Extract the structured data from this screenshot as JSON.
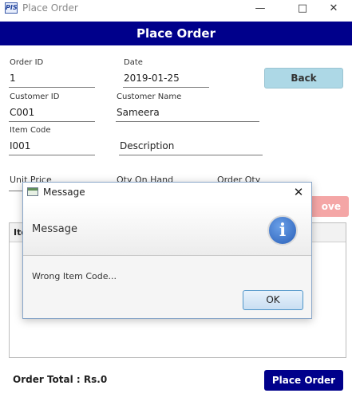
{
  "window": {
    "title": "Place Order",
    "icon": "app-logo-icon",
    "logo_text": "PIS"
  },
  "header": {
    "title": "Place Order"
  },
  "form": {
    "order_id": {
      "label": "Order ID",
      "value": "1"
    },
    "date": {
      "label": "Date",
      "value": "2019-01-25"
    },
    "customer_id": {
      "label": "Customer ID",
      "value": "C001"
    },
    "customer_name": {
      "label": "Customer Name",
      "value": "Sameera"
    },
    "item_code": {
      "label": "Item Code",
      "value": "I001"
    },
    "description": {
      "placeholder": "Description",
      "value": ""
    },
    "unit_price": {
      "label": "Unit Price"
    },
    "qty_on_hand": {
      "label": "Qty On Hand"
    },
    "order_qty": {
      "label": "Order Qty"
    }
  },
  "buttons": {
    "back": "Back",
    "remove_partial": "ove",
    "place_order": "Place Order"
  },
  "table": {
    "first_column_partial": "Ite"
  },
  "footer": {
    "order_total_label": "Order Total :",
    "order_total_value": "Rs.0"
  },
  "dialog": {
    "title": "Message",
    "header": "Message",
    "message": "Wrong Item Code...",
    "ok_label": "OK",
    "icon": "info-icon"
  },
  "colors": {
    "header_bg": "#00008b",
    "back_button": "#add8e6",
    "remove_button": "#f4a6a6",
    "place_order_button": "#00008b"
  }
}
